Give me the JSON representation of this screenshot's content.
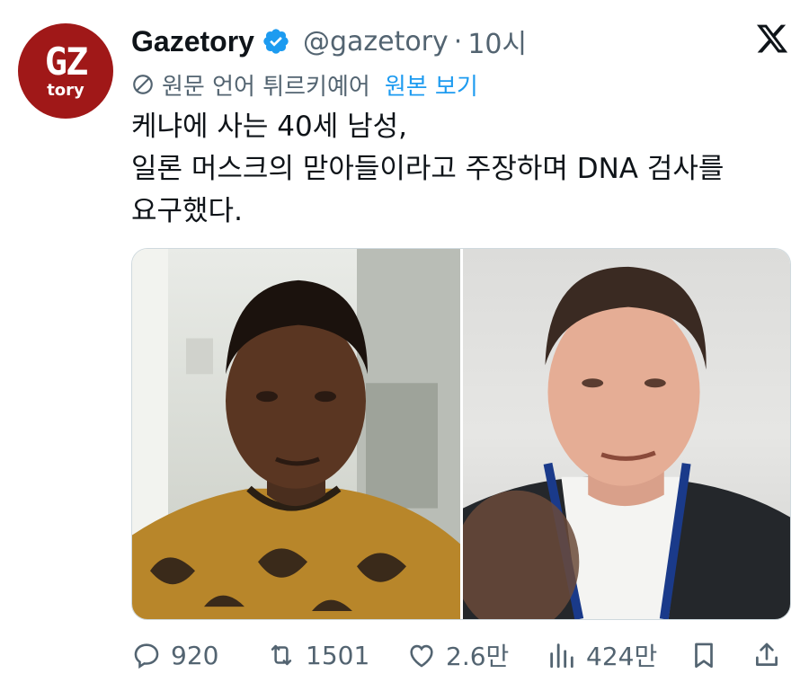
{
  "author": {
    "display_name": "Gazetory",
    "handle": "@gazetory",
    "separator": "·",
    "time": "10시",
    "avatar_text_top": "GZ",
    "avatar_text_bottom": "tory",
    "avatar_color": "#a01818"
  },
  "translation": {
    "label": "원문 언어 튀르키예어",
    "show_original": "원본 보기",
    "icon": "translate-icon"
  },
  "tweet": {
    "lines": [
      "케냐에 사는 40세 남성,",
      "일론 머스크의 맏아들이라고 주장하며 DNA 검사를",
      "요구했다."
    ]
  },
  "media": {
    "photos": [
      "photo-man-patterned-shirt",
      "photo-elon-musk"
    ]
  },
  "actions": {
    "replies": "920",
    "reposts": "1501",
    "likes": "2.6만",
    "views": "424만"
  },
  "colors": {
    "accent": "#1d9bf0",
    "muted": "#536471",
    "text": "#0f1419"
  }
}
